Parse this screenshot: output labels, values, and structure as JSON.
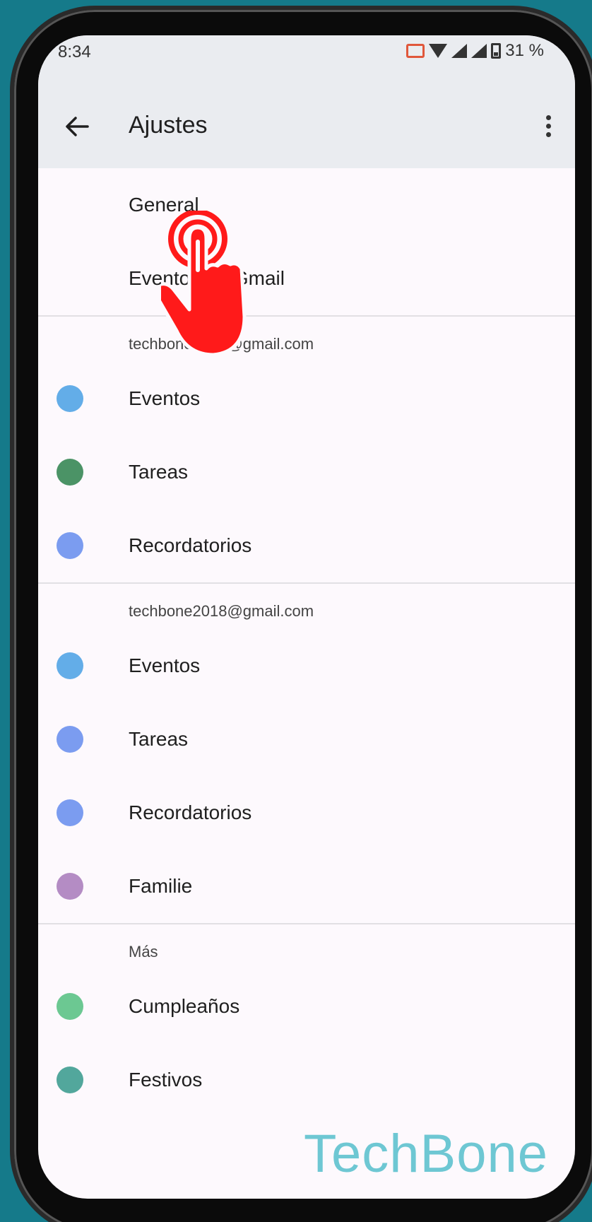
{
  "status_bar": {
    "time": "8:34",
    "battery": "31 %",
    "icons": [
      "cast-icon",
      "wifi-icon",
      "signal-icon",
      "signal-roaming-icon",
      "battery-icon"
    ]
  },
  "appbar": {
    "title": "Ajustes",
    "back_icon": "arrow-back-icon",
    "more_icon": "more-vert-icon"
  },
  "top_items": [
    {
      "label": "General"
    },
    {
      "label": "Eventos de Gmail"
    }
  ],
  "accounts": [
    {
      "email": "techbone2020@gmail.com",
      "calendars": [
        {
          "label": "Eventos",
          "color": "#63ade8"
        },
        {
          "label": "Tareas",
          "color": "#4b9366"
        },
        {
          "label": "Recordatorios",
          "color": "#7b9cf0"
        }
      ]
    },
    {
      "email": "techbone2018@gmail.com",
      "calendars": [
        {
          "label": "Eventos",
          "color": "#63ade8"
        },
        {
          "label": "Tareas",
          "color": "#7b9cf0"
        },
        {
          "label": "Recordatorios",
          "color": "#7b9cf0"
        },
        {
          "label": "Familie",
          "color": "#b48cc4"
        }
      ]
    }
  ],
  "more_section": {
    "header": "Más",
    "calendars": [
      {
        "label": "Cumpleaños",
        "color": "#6cc892"
      },
      {
        "label": "Festivos",
        "color": "#52a79c"
      }
    ]
  },
  "watermark": "TechBone",
  "colors": {
    "appbar_bg": "#eaecf0",
    "screen_bg": "#fdf9fd",
    "background": "#157a8a",
    "tap_indicator": "#ff1a1a"
  }
}
